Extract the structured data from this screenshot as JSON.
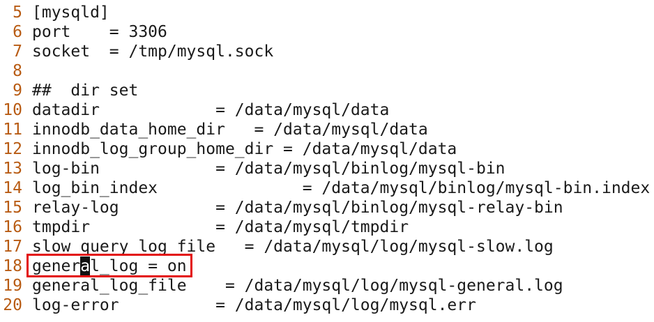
{
  "editor": {
    "lines": [
      {
        "number": "5",
        "text": "[mysqld]"
      },
      {
        "number": "6",
        "text": "port    = 3306"
      },
      {
        "number": "7",
        "text": "socket  = /tmp/mysql.sock"
      },
      {
        "number": "8",
        "text": ""
      },
      {
        "number": "9",
        "text": "##  dir set"
      },
      {
        "number": "10",
        "text": "datadir            = /data/mysql/data"
      },
      {
        "number": "11",
        "text": "innodb_data_home_dir   = /data/mysql/data"
      },
      {
        "number": "12",
        "text": "innodb_log_group_home_dir = /data/mysql/data"
      },
      {
        "number": "13",
        "text": "log-bin            = /data/mysql/binlog/mysql-bin"
      },
      {
        "number": "14",
        "text": "log_bin_index               = /data/mysql/binlog/mysql-bin.index"
      },
      {
        "number": "15",
        "text": "relay-log          = /data/mysql/binlog/mysql-relay-bin"
      },
      {
        "number": "16",
        "text": "tmpdir             = /data/mysql/tmpdir"
      },
      {
        "number": "17",
        "text": "slow_query_log_file   = /data/mysql/log/mysql-slow.log"
      },
      {
        "number": "18",
        "text_before_cursor": "gener",
        "cursor_char": "a",
        "text_after_cursor": "l_log = on",
        "highlighted": true
      },
      {
        "number": "19",
        "text": "general_log_file    = /data/mysql/log/mysql-general.log"
      },
      {
        "number": "20",
        "text": "log-error          = /data/mysql/log/mysql.err"
      }
    ]
  },
  "colors": {
    "line_number": "#b85b13",
    "highlight_border": "#e30d0d",
    "cursor_background": "#111111",
    "text": "#1a1a1a"
  }
}
